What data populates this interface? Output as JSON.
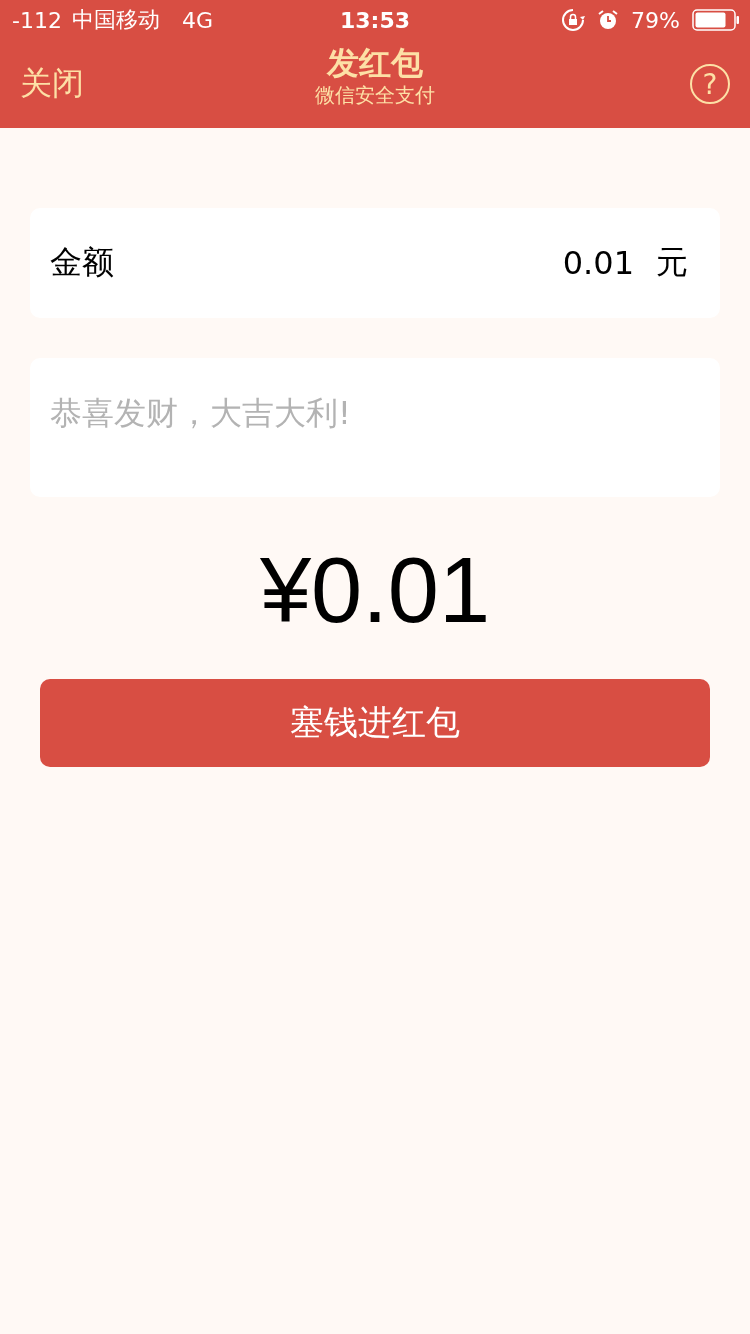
{
  "status_bar": {
    "signal": "-112",
    "carrier": "中国移动",
    "network": "4G",
    "time": "13:53",
    "battery": "79%"
  },
  "nav": {
    "close": "关闭",
    "title": "发红包",
    "subtitle": "微信安全支付",
    "help": "?"
  },
  "amount_field": {
    "label": "金额",
    "value": "0.01",
    "unit": "元"
  },
  "message_field": {
    "placeholder": "恭喜发财，大吉大利!"
  },
  "total": "¥0.01",
  "submit_button": "塞钱进红包"
}
